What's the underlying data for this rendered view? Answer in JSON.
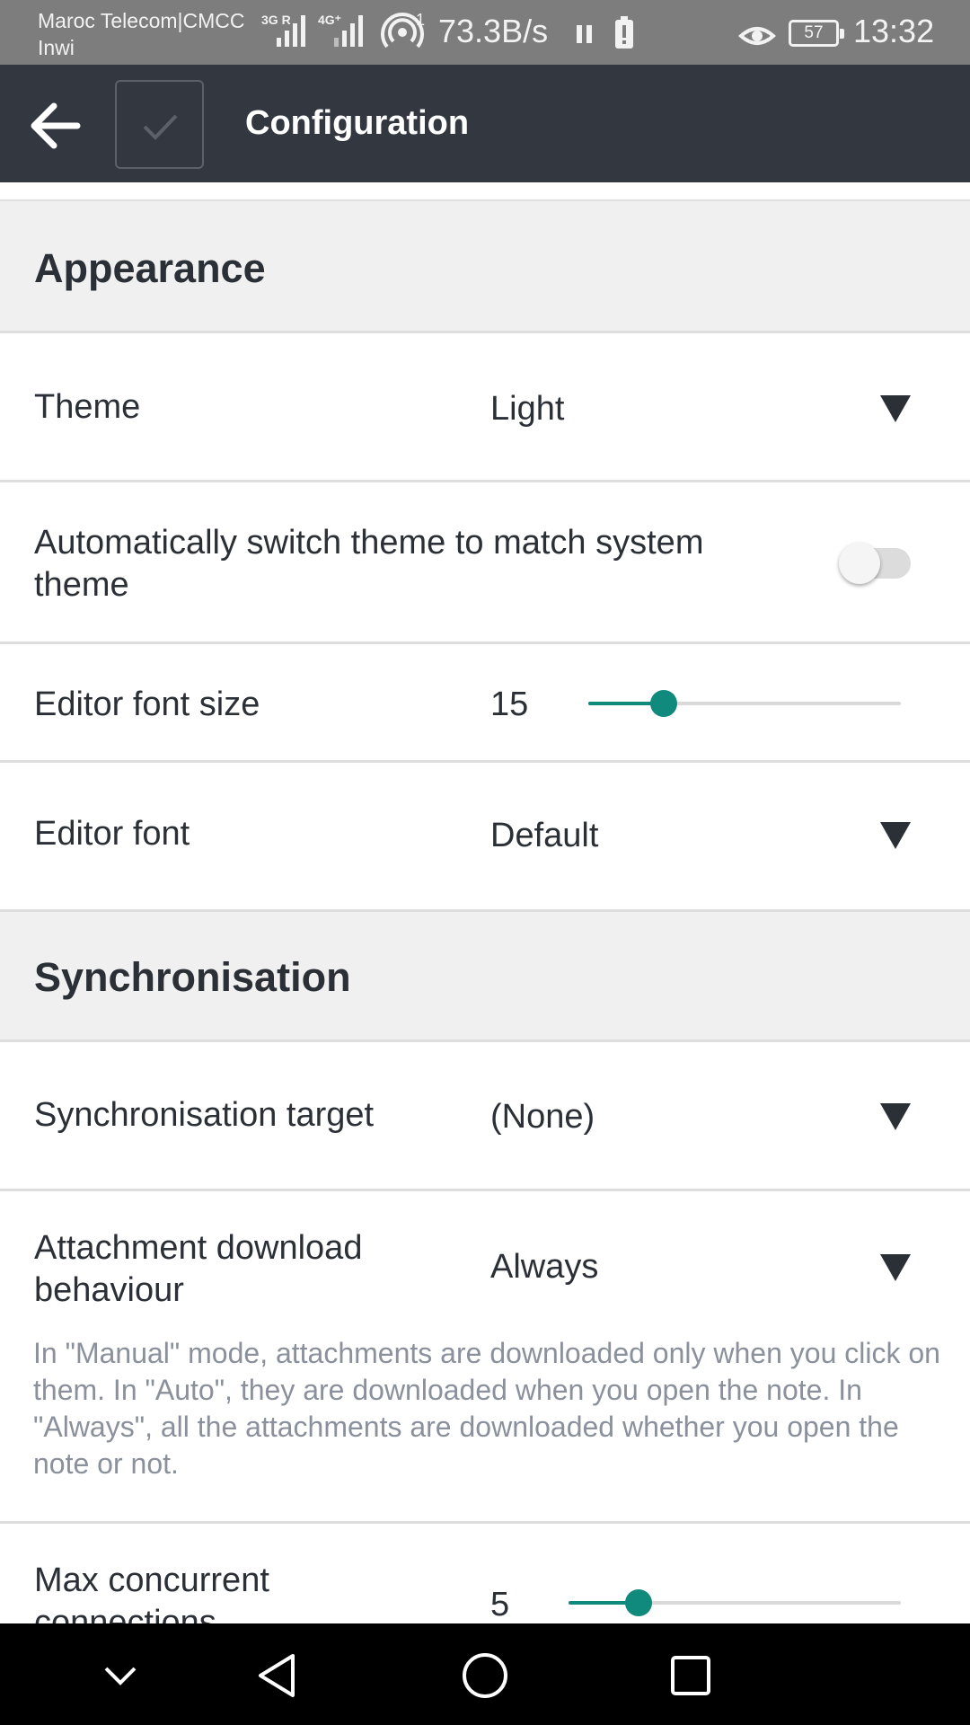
{
  "status_bar": {
    "carrier_line1": "Maroc Telecom|CMCC",
    "carrier_line2": "Inwi",
    "net1": "3G R",
    "net2": "4G⁺",
    "hotspot_sup": "1",
    "speed": "73.3B/s",
    "battery": "57",
    "time": "13:32"
  },
  "app_bar": {
    "title": "Configuration"
  },
  "sections": {
    "appearance": {
      "title": "Appearance",
      "theme": {
        "label": "Theme",
        "value": "Light"
      },
      "auto_switch": {
        "label_line1": "Automatically switch theme to match system",
        "label_line2": "theme",
        "enabled": false
      },
      "font_size": {
        "label": "Editor font size",
        "value": "15",
        "level": 0.24
      },
      "editor_font": {
        "label": "Editor font",
        "value": "Default"
      }
    },
    "sync": {
      "title": "Synchronisation",
      "target": {
        "label": "Synchronisation target",
        "value": "(None)"
      },
      "attachment": {
        "label_line1": "Attachment download",
        "label_line2": "behaviour",
        "value": "Always",
        "description": "In \"Manual\" mode, attachments are downloaded only when you click on them. In \"Auto\", they are downloaded when you open the note. In \"Always\", all the attachments are downloaded whether you open the note or not."
      },
      "max_connections": {
        "label_line1": "Max concurrent",
        "label_line2": "connections",
        "value": "5",
        "level": 0.21
      }
    }
  },
  "colors": {
    "status_bar": "#7d7d7d",
    "app_bar": "#333740",
    "section_bg": "#f0f0f0",
    "accent": "#0f8a7c",
    "nav_bar": "#000000"
  },
  "icons": {
    "back": "arrow-left-icon",
    "save": "checkmark-icon",
    "dropdown": "triangle-down-icon",
    "nav_hide": "chevron-down-icon",
    "nav_back": "triangle-back-icon",
    "nav_home": "circle-home-icon",
    "nav_recents": "square-recents-icon"
  }
}
